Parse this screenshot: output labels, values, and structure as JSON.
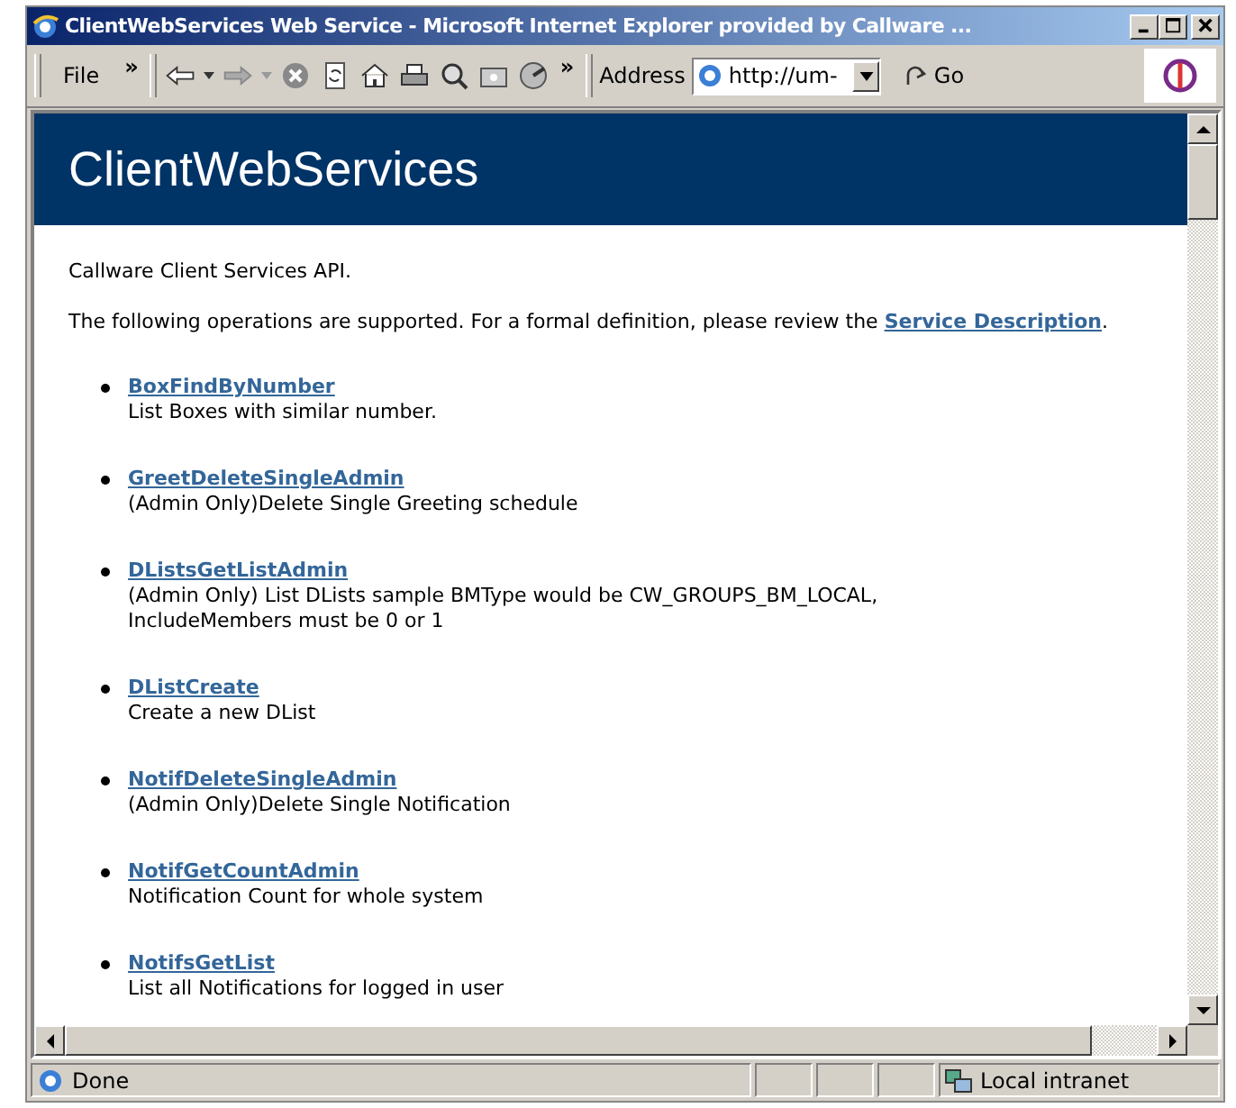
{
  "window": {
    "title": "ClientWebServices Web Service - Microsoft Internet Explorer provided by Callware ..."
  },
  "toolbar": {
    "menu": "File",
    "chevron_menu": "»",
    "chevron_buttons": "»",
    "address_label": "Address",
    "address": "http://um-",
    "go": "Go"
  },
  "page": {
    "heading": "ClientWebServices",
    "intro": "Callware Client Services API.",
    "lead": "The following operations are supported. For a formal definition, please review the ",
    "lead_link": "Service Description",
    "lead_end": ".",
    "operations": [
      {
        "name": "BoxFindByNumber",
        "description": "List Boxes with similar number."
      },
      {
        "name": "GreetDeleteSingleAdmin",
        "description": "(Admin Only)Delete Single Greeting schedule"
      },
      {
        "name": "DListsGetListAdmin",
        "description": "(Admin Only) List DLists sample BMType would be CW_GROUPS_BM_LOCAL, IncludeMembers must be 0 or 1"
      },
      {
        "name": "DListCreate",
        "description": "Create a new DList"
      },
      {
        "name": "NotifDeleteSingleAdmin",
        "description": "(Admin Only)Delete Single Notification"
      },
      {
        "name": "NotifGetCountAdmin",
        "description": "Notification Count for whole system"
      },
      {
        "name": "NotifsGetList",
        "description": "List all Notifications for logged in user"
      }
    ]
  },
  "status_bar": {
    "status": "Done",
    "zone": "Local intranet"
  }
}
